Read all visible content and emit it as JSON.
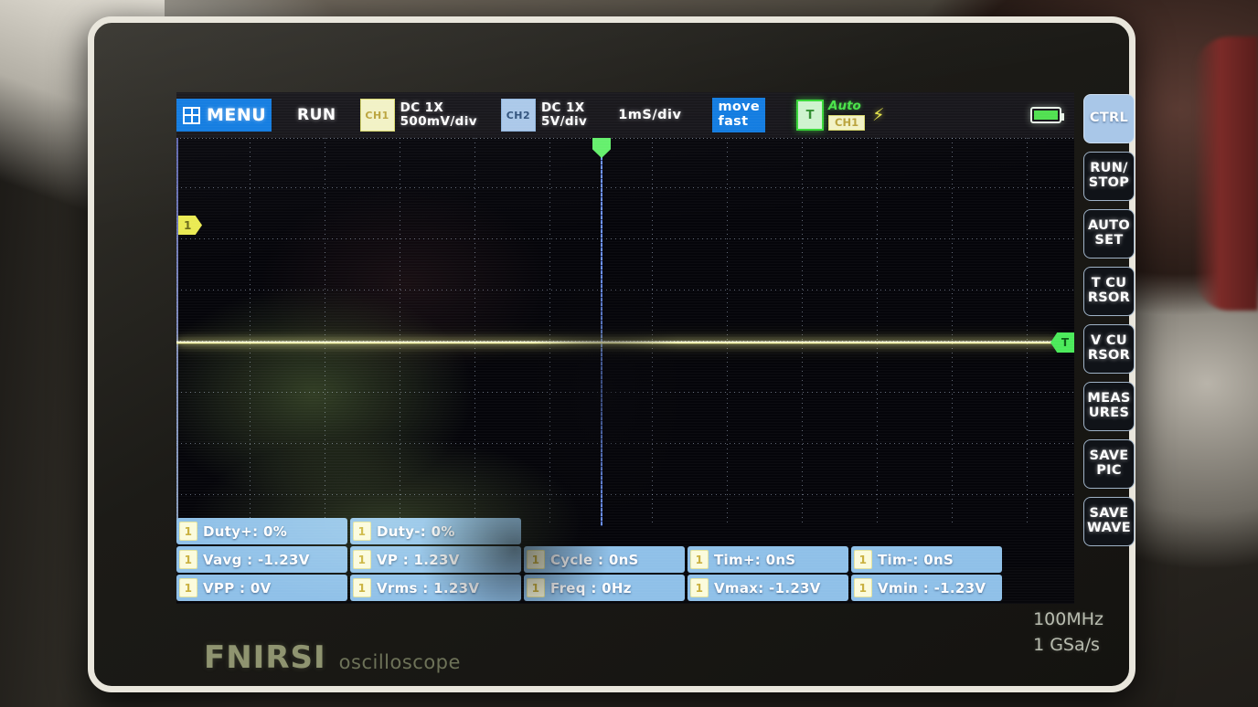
{
  "device": {
    "brand": "FNIRSI",
    "product_label": "oscilloscope",
    "spec_bandwidth": "100MHz",
    "spec_samplerate": "1  GSa/s"
  },
  "topbar": {
    "menu_label": "MENU",
    "menu_icon": "hamburger-grid-icon",
    "run_state": "RUN",
    "ch1": {
      "chip": "CH1",
      "coupling": "DC  1X",
      "scale": "500mV/div"
    },
    "ch2": {
      "chip": "CH2",
      "coupling": "DC  1X",
      "scale": "5V/div"
    },
    "timebase": "1mS/div",
    "move_mode": {
      "line1": "move",
      "line2": "fast"
    },
    "trigger": {
      "box": "T",
      "mode": "Auto",
      "source": "CH1",
      "edge_icon": "rising-edge-icon"
    },
    "battery_icon": "battery-full-icon"
  },
  "plot": {
    "ch1_ground_marker": "1",
    "trigger_level_marker": "T",
    "trigger_position_marker": "trigger-position-icon"
  },
  "measurements": {
    "rows": [
      [
        {
          "tag": "1",
          "text": "Duty+: 0%",
          "width": "w200"
        },
        {
          "tag": "1",
          "text": "Duty-: 0%",
          "width": "w200"
        }
      ],
      [
        {
          "tag": "1",
          "text": "Vavg : -1.23V",
          "width": "w200"
        },
        {
          "tag": "1",
          "text": "VP   : 1.23V",
          "width": "w200"
        },
        {
          "tag": "1",
          "text": "Cycle : 0nS",
          "width": "w175"
        },
        {
          "tag": "1",
          "text": "Tim+: 0nS",
          "width": "w175"
        },
        {
          "tag": "1",
          "text": "Tim-: 0nS",
          "width": "w165"
        }
      ],
      [
        {
          "tag": "1",
          "text": "VPP  : 0V",
          "width": "w200"
        },
        {
          "tag": "1",
          "text": "Vrms : 1.23V",
          "width": "w200"
        },
        {
          "tag": "1",
          "text": "Freq : 0Hz",
          "width": "w175"
        },
        {
          "tag": "1",
          "text": "Vmax: -1.23V",
          "width": "w175"
        },
        {
          "tag": "1",
          "text": "Vmin : -1.23V",
          "width": "w165"
        }
      ]
    ]
  },
  "side_buttons": [
    {
      "line1": "CTRL",
      "line2": "",
      "active": true
    },
    {
      "line1": "RUN/",
      "line2": "STOP",
      "active": false
    },
    {
      "line1": "AUTO",
      "line2": "SET",
      "active": false
    },
    {
      "line1": "T CU",
      "line2": "RSOR",
      "active": false
    },
    {
      "line1": "V CU",
      "line2": "RSOR",
      "active": false
    },
    {
      "line1": "MEAS",
      "line2": "URES",
      "active": false
    },
    {
      "line1": "SAVE",
      "line2": "PIC",
      "active": false
    },
    {
      "line1": "SAVE",
      "line2": "WAVE",
      "active": false
    }
  ],
  "colors": {
    "ch1": "#eaea52",
    "ch2": "#a9c7e8",
    "trigger": "#4bea5a",
    "accent_blue": "#0f7ae0",
    "measure_panel": "#8fc0e8"
  }
}
